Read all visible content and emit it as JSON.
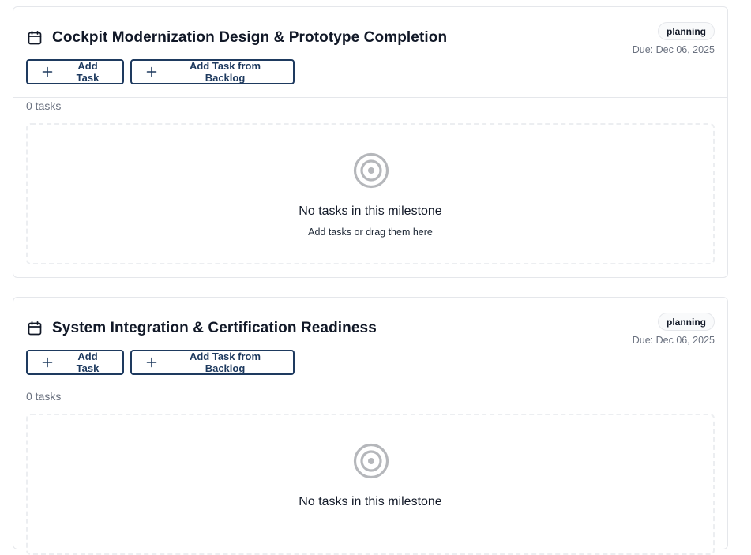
{
  "milestones": [
    {
      "title": "Cockpit Modernization Design & Prototype Completion",
      "status": "planning",
      "due": "Due: Dec 06, 2025",
      "add_task_label": "Add Task",
      "add_backlog_label": "Add Task from Backlog",
      "task_count": "0 tasks",
      "empty_title": "No tasks in this milestone",
      "empty_subtitle": "Add tasks or drag them here"
    },
    {
      "title": "System Integration & Certification Readiness",
      "status": "planning",
      "due": "Due: Dec 06, 2025",
      "add_task_label": "Add Task",
      "add_backlog_label": "Add Task from Backlog",
      "task_count": "0 tasks",
      "empty_title": "No tasks in this milestone",
      "empty_subtitle": ""
    }
  ],
  "icons": {
    "calendar": "calendar-icon",
    "plus": "plus-icon",
    "target": "target-icon"
  },
  "colors": {
    "button_border": "#1e3a5f",
    "card_border": "#e5e7eb",
    "muted_text": "#6b7280",
    "icon_gray": "#b5b7bb"
  }
}
